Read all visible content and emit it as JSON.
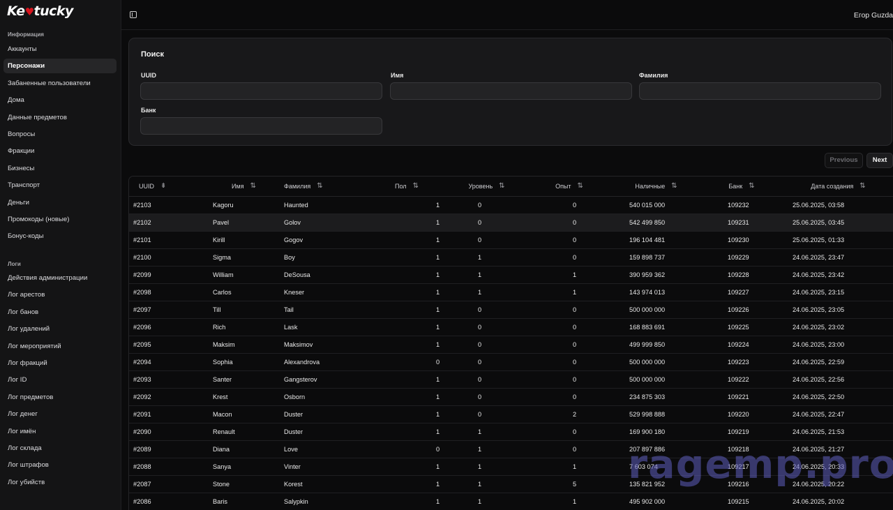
{
  "app": {
    "logo_text_pre": "Ke",
    "logo_text_post": "tucky"
  },
  "header": {
    "user_name": "Егор Guzda"
  },
  "sidebar": {
    "groups": [
      {
        "title": "Информация",
        "items": [
          "Аккаунты",
          "Персонажи",
          "Забаненные пользователи",
          "Дома",
          "Данные предметов",
          "Вопросы",
          "Фракции",
          "Бизнесы",
          "Транспорт",
          "Деньги",
          "Промокоды (новые)",
          "Бонус-коды"
        ]
      },
      {
        "title": "Логи",
        "items": [
          "Действия администрации",
          "Лог арестов",
          "Лог банов",
          "Лог удалений",
          "Лог мероприятий",
          "Лог фракций",
          "Лог ID",
          "Лог предметов",
          "Лог денег",
          "Лог имён",
          "Лог склада",
          "Лог штрафов",
          "Лог убийств"
        ]
      }
    ],
    "active_item": "Персонажи"
  },
  "search": {
    "title": "Поиск",
    "fields": [
      {
        "label": "UUID",
        "value": ""
      },
      {
        "label": "Имя",
        "value": ""
      },
      {
        "label": "Фамилия",
        "value": ""
      },
      {
        "label": "Банк",
        "value": ""
      }
    ]
  },
  "pagination": {
    "previous_label": "Previous",
    "next_label": "Next"
  },
  "table": {
    "columns": [
      "UUID",
      "Имя",
      "Фамилия",
      "Пол",
      "Уровень",
      "Опыт",
      "Наличные",
      "Банк",
      "Дата создания"
    ],
    "rows": [
      [
        "#2103",
        "Kagoru",
        "Haunted",
        "1",
        "0",
        "0",
        "540 015 000",
        "109232",
        "25.06.2025, 03:58"
      ],
      [
        "#2102",
        "Pavel",
        "Golov",
        "1",
        "0",
        "0",
        "542 499 850",
        "109231",
        "25.06.2025, 03:45"
      ],
      [
        "#2101",
        "Kirill",
        "Gogov",
        "1",
        "0",
        "0",
        "196 104 481",
        "109230",
        "25.06.2025, 01:33"
      ],
      [
        "#2100",
        "Sigma",
        "Boy",
        "1",
        "1",
        "0",
        "159 898 737",
        "109229",
        "24.06.2025, 23:47"
      ],
      [
        "#2099",
        "William",
        "DeSousa",
        "1",
        "1",
        "1",
        "390 959 362",
        "109228",
        "24.06.2025, 23:42"
      ],
      [
        "#2098",
        "Carlos",
        "Kneser",
        "1",
        "1",
        "1",
        "143 974 013",
        "109227",
        "24.06.2025, 23:15"
      ],
      [
        "#2097",
        "Till",
        "Tail",
        "1",
        "0",
        "0",
        "500 000 000",
        "109226",
        "24.06.2025, 23:05"
      ],
      [
        "#2096",
        "Rich",
        "Lask",
        "1",
        "0",
        "0",
        "168 883 691",
        "109225",
        "24.06.2025, 23:02"
      ],
      [
        "#2095",
        "Maksim",
        "Maksimov",
        "1",
        "0",
        "0",
        "499 999 850",
        "109224",
        "24.06.2025, 23:00"
      ],
      [
        "#2094",
        "Sophia",
        "Alexandrova",
        "0",
        "0",
        "0",
        "500 000 000",
        "109223",
        "24.06.2025, 22:59"
      ],
      [
        "#2093",
        "Santer",
        "Gangsterov",
        "1",
        "0",
        "0",
        "500 000 000",
        "109222",
        "24.06.2025, 22:56"
      ],
      [
        "#2092",
        "Krest",
        "Osborn",
        "1",
        "0",
        "0",
        "234 875 303",
        "109221",
        "24.06.2025, 22:50"
      ],
      [
        "#2091",
        "Macon",
        "Duster",
        "1",
        "0",
        "2",
        "529 998 888",
        "109220",
        "24.06.2025, 22:47"
      ],
      [
        "#2090",
        "Renault",
        "Duster",
        "1",
        "1",
        "0",
        "169 900 180",
        "109219",
        "24.06.2025, 21:53"
      ],
      [
        "#2089",
        "Diana",
        "Love",
        "0",
        "1",
        "0",
        "207 897 886",
        "109218",
        "24.06.2025, 21:27"
      ],
      [
        "#2088",
        "Sanya",
        "Vinter",
        "1",
        "1",
        "1",
        "7 603 074",
        "109217",
        "24.06.2025, 20:33"
      ],
      [
        "#2087",
        "Stone",
        "Korest",
        "1",
        "1",
        "5",
        "135 821 952",
        "109216",
        "24.06.2025, 20:22"
      ],
      [
        "#2086",
        "Baris",
        "Salypkin",
        "1",
        "1",
        "1",
        "495 902 000",
        "109215",
        "24.06.2025, 20:02"
      ]
    ],
    "highlighted_row": 1
  },
  "watermark": {
    "text": "ragemp.pro"
  },
  "colors": {
    "background": "#0b0b0c",
    "sidebar": "#141415",
    "card": "#18181a",
    "watermark": "#5f5fbe",
    "logo_heart": "#d8141d"
  },
  "icons": {
    "sidebar_toggle": "sidebar-toggle-icon",
    "sort_desc": "sort-descending-icon",
    "sort_both": "sort-arrows-icon"
  }
}
